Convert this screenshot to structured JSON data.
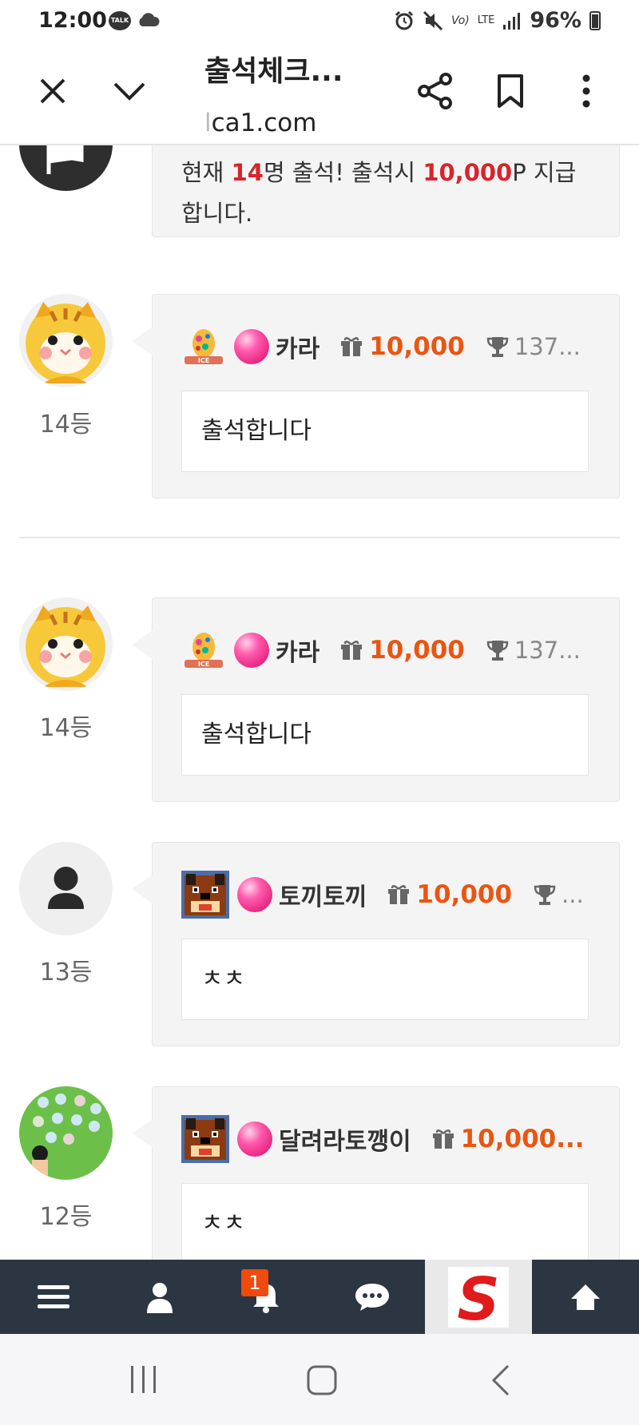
{
  "status": {
    "time": "12:00",
    "talk": "TALK",
    "carrier": "Vo)",
    "network": "LTE",
    "battery": "96%"
  },
  "browser": {
    "title": "출석체크...",
    "url_fade": "l",
    "url_main": "ca1.com"
  },
  "notice": {
    "pre": "현재 ",
    "count": "14",
    "mid": "명 출석! 출석시 ",
    "points": "10,000",
    "post": "P 지급 합니다."
  },
  "comments": [
    {
      "rank": "14등",
      "name": "카라",
      "points": "10,000",
      "trophy": "137...",
      "text": "출석합니다"
    },
    {
      "rank": "14등",
      "name": "카라",
      "points": "10,000",
      "trophy": "137...",
      "text": "출석합니다"
    },
    {
      "rank": "13등",
      "name": "토끼토끼",
      "points": "10,000",
      "trophy": "...",
      "text": "ㅊㅊ"
    },
    {
      "rank": "12등",
      "name": "달려라토깽이",
      "points": "10,000...",
      "trophy": "",
      "text": "ㅊㅊ"
    }
  ],
  "bottom_nav": {
    "notification_count": "1",
    "logo_letter": "S"
  },
  "colors": {
    "accent_red": "#d8242c",
    "point_orange": "#ea5511",
    "nav_bg": "#2c3542"
  }
}
